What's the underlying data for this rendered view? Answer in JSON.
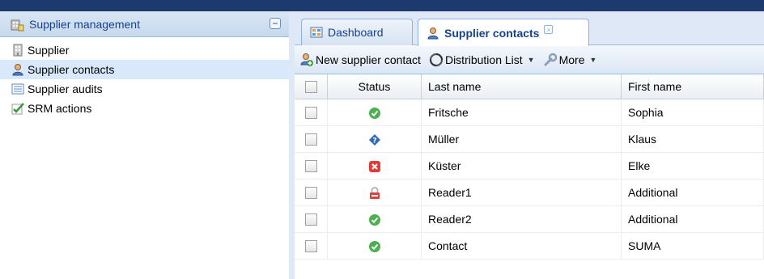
{
  "left": {
    "title": "Supplier management",
    "collapse": "−",
    "items": [
      {
        "label": "Supplier",
        "icon": "building-icon"
      },
      {
        "label": "Supplier contacts",
        "icon": "contacts-icon",
        "selected": true
      },
      {
        "label": "Supplier audits",
        "icon": "list-icon"
      },
      {
        "label": "SRM actions",
        "icon": "check-icon"
      }
    ]
  },
  "tabs": [
    {
      "label": "Dashboard",
      "icon": "dashboard-icon"
    },
    {
      "label": "Supplier contacts",
      "icon": "contacts-icon",
      "active": true,
      "close": "×"
    }
  ],
  "toolbar": {
    "new_label": "New supplier contact",
    "dist_label": "Distribution List",
    "more_label": "More",
    "arrow": "▼"
  },
  "grid": {
    "columns": [
      "Status",
      "Last name",
      "First name"
    ],
    "rows": [
      {
        "status": "ok",
        "last": "Fritsche",
        "first": "Sophia"
      },
      {
        "status": "unknown",
        "last": "Müller",
        "first": "Klaus"
      },
      {
        "status": "error",
        "last": "Küster",
        "first": "Elke"
      },
      {
        "status": "locked",
        "last": "Reader1",
        "first": "Additional"
      },
      {
        "status": "ok",
        "last": "Reader2",
        "first": "Additional"
      },
      {
        "status": "ok",
        "last": "Contact",
        "first": "SUMA"
      }
    ]
  },
  "colors": {
    "accent": "#15428b",
    "ok": "#4caf50",
    "error": "#e53935",
    "info": "#2f6db5"
  }
}
